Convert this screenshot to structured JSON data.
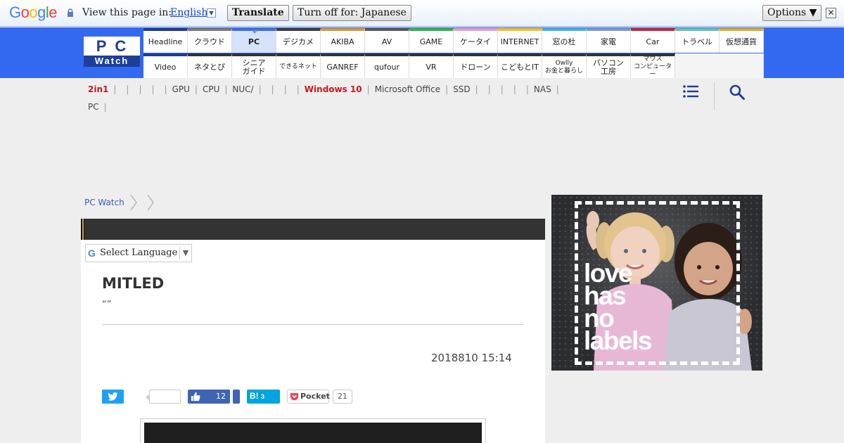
{
  "translate_bar": {
    "logo": "Google",
    "label": "View this page in:",
    "language": "English",
    "dropdown_arrow": "▼",
    "translate_button": "Translate",
    "turn_off_button": "Turn off for: Japanese",
    "options_button": "Options ▼",
    "close_glyph": "✕"
  },
  "site": {
    "logo_top": "PC",
    "logo_bottom": "Watch",
    "brand_color": "#3369f0"
  },
  "nav": {
    "row1": [
      {
        "label": "Headline",
        "color": "#1e3c96"
      },
      {
        "label": "クラウド",
        "color": "#7a7a7a"
      },
      {
        "label": "PC",
        "color": "#3d6fe0",
        "active": true
      },
      {
        "label": "デジカメ",
        "color": "#3f3f3f"
      },
      {
        "label": "AKIBA",
        "color": "#d59a3e"
      },
      {
        "label": "AV",
        "color": "#5a5a5a"
      },
      {
        "label": "GAME",
        "color": "#3ab24b"
      },
      {
        "label": "ケータイ",
        "color": "#e3a1c6"
      },
      {
        "label": "INTERNET",
        "color": "#f0c22a"
      },
      {
        "label": "窓の杜",
        "color": "#4ab0d9"
      },
      {
        "label": "家電",
        "color": "#7a9bd0"
      },
      {
        "label": "Car",
        "color": "#c42b3b"
      },
      {
        "label": "トラベル",
        "color": "#69c1b2"
      },
      {
        "label": "仮想通貨",
        "color": "#d8ad35"
      }
    ],
    "row2": [
      {
        "label": "Video",
        "color": "#1e3c96"
      },
      {
        "label": "ネタとぴ",
        "color": "#333333"
      },
      {
        "label": "シニア\nガイド",
        "color": "#333333"
      },
      {
        "label": "できるネット",
        "color": "#333333",
        "small": true
      },
      {
        "label": "GANREF",
        "color": "#333333"
      },
      {
        "label": "qufour",
        "color": "#333333"
      },
      {
        "label": "VR",
        "color": "#333333"
      },
      {
        "label": "ドローン",
        "color": "#333333"
      },
      {
        "label": "こどもとIT",
        "color": "#333333"
      },
      {
        "label": "Owlly\nお金と暮らし",
        "color": "#333333",
        "small": true
      },
      {
        "label": "パソコン\n工房",
        "color": "#333333"
      },
      {
        "label": "マウス\nコンピューター",
        "color": "#333333",
        "small": true
      }
    ]
  },
  "tags": {
    "line1": [
      "2in1",
      "",
      "",
      "",
      "",
      "GPU",
      "CPU",
      "NUC/",
      "",
      "",
      "",
      "Windows 10",
      "Microsoft Office",
      "SSD",
      "",
      "",
      "",
      "",
      "NAS"
    ],
    "line2": [
      "PC"
    ],
    "highlight": [
      "2in1",
      "Windows 10"
    ],
    "separator": "|"
  },
  "breadcrumb": {
    "home": "PC Watch"
  },
  "article": {
    "select_language": "Select Language",
    "select_arrow": "▼",
    "title": "MITLED",
    "subtitle": "“”",
    "date": "2018810 15:14",
    "share": {
      "facebook_count": "12",
      "hatena_label": "B!",
      "hatena_count": "3",
      "pocket_label": "Pocket",
      "pocket_count": "21"
    }
  },
  "ad": {
    "slogan": "love\nhas\nno\nlabels"
  }
}
